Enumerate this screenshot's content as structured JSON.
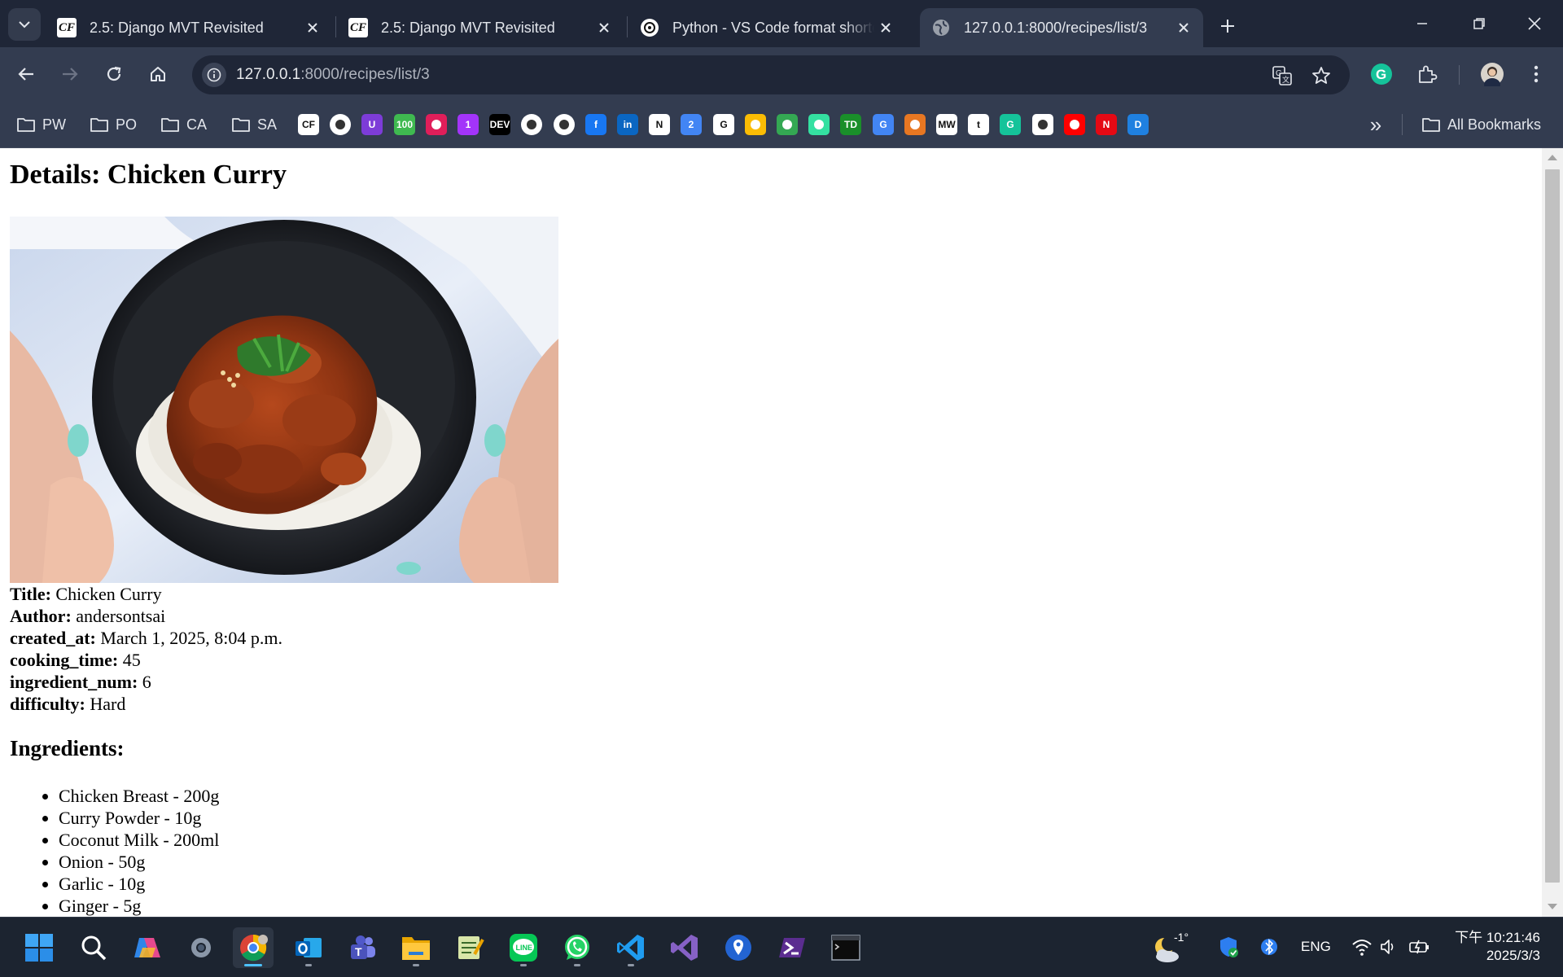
{
  "tabs": [
    {
      "title": "2.5: Django MVT Revisited",
      "favicon": "cf-icon",
      "active": false
    },
    {
      "title": "2.5: Django MVT Revisited",
      "favicon": "cf-icon",
      "active": false
    },
    {
      "title": "Python - VS Code format shortcut",
      "favicon": "chatgpt-icon",
      "active": false
    },
    {
      "title": "127.0.0.1:8000/recipes/list/3",
      "favicon": "globe-icon",
      "active": true
    }
  ],
  "cf_favicon_text": "CF",
  "address_bar": {
    "host": "127.0.0.1",
    "path": ":8000/recipes/list/3"
  },
  "bookmarks": {
    "folders": [
      "PW",
      "PO",
      "CA",
      "SA"
    ],
    "icons": [
      {
        "name": "cf-icon",
        "text": "CF",
        "color": "#ffffff"
      },
      {
        "name": "github-icon",
        "color": "#ffffff"
      },
      {
        "name": "ublock-icon",
        "text": "U",
        "color": "#7d3cd8"
      },
      {
        "name": "hundred-icon",
        "text": "100",
        "color": "#3fb950"
      },
      {
        "name": "slack-icon",
        "color": "#e01e5a"
      },
      {
        "name": "messenger-icon",
        "text": "1",
        "color": "#a334fa"
      },
      {
        "name": "dev-icon",
        "text": "DEV",
        "color": "#000000"
      },
      {
        "name": "chatgpt-icon",
        "color": "#ffffff"
      },
      {
        "name": "perplexity-icon",
        "color": "#ffffff"
      },
      {
        "name": "facebook-icon",
        "text": "f",
        "color": "#1877f2"
      },
      {
        "name": "linkedin-icon",
        "text": "in",
        "color": "#0a66c2"
      },
      {
        "name": "notion-icon",
        "text": "N",
        "color": "#ffffff"
      },
      {
        "name": "calendar-icon",
        "text": "2",
        "color": "#4285f4"
      },
      {
        "name": "google-icon",
        "text": "G",
        "color": "#ffffff"
      },
      {
        "name": "drive-icon",
        "color": "#fbbc04"
      },
      {
        "name": "maps-icon",
        "color": "#34a853"
      },
      {
        "name": "tripadvisor-icon",
        "color": "#34e0a1"
      },
      {
        "name": "td-icon",
        "text": "TD",
        "color": "#1a8f2a"
      },
      {
        "name": "translate-icon",
        "text": "G",
        "color": "#4285f4"
      },
      {
        "name": "university-icon",
        "color": "#e87722"
      },
      {
        "name": "mw-icon",
        "text": "MW",
        "color": "#ffffff"
      },
      {
        "name": "tumblr-icon",
        "text": "t",
        "color": "#ffffff"
      },
      {
        "name": "grammarly-icon",
        "text": "G",
        "color": "#15c39a"
      },
      {
        "name": "bank-icon",
        "color": "#ffffff"
      },
      {
        "name": "youtube-icon",
        "color": "#ff0000"
      },
      {
        "name": "netflix-icon",
        "text": "N",
        "color": "#e50914"
      },
      {
        "name": "disney-icon",
        "text": "D",
        "color": "#1f80e0"
      }
    ],
    "overflow": "»",
    "all_bookmarks": "All Bookmarks"
  },
  "page": {
    "heading": "Details: Chicken Curry",
    "fields": [
      {
        "label": "Title:",
        "value": "Chicken Curry"
      },
      {
        "label": "Author:",
        "value": "andersontsai"
      },
      {
        "label": "created_at:",
        "value": "March 1, 2025, 8:04 p.m."
      },
      {
        "label": "cooking_time:",
        "value": "45"
      },
      {
        "label": "ingredient_num:",
        "value": "6"
      },
      {
        "label": "difficulty:",
        "value": "Hard"
      }
    ],
    "ingredients_heading": "Ingredients:",
    "ingredients": [
      "Chicken Breast - 200g",
      "Curry Powder - 10g",
      "Coconut Milk - 200ml",
      "Onion - 50g",
      "Garlic - 10g",
      "Ginger - 5g"
    ]
  },
  "taskbar": {
    "apps": [
      "start-icon",
      "search-icon",
      "copilot-icon",
      "settings-icon",
      "chrome-icon",
      "outlook-icon",
      "teams-icon",
      "file-explorer-icon",
      "notepad-icon",
      "line-icon",
      "whatsapp-icon",
      "vscode-icon",
      "visual-studio-icon",
      "maps-pin-icon",
      "powershell-icon",
      "terminal-icon"
    ],
    "line_label": "LINE",
    "weather": "-1°",
    "lang": "ENG",
    "time": "下午 10:21:46",
    "date": "2025/3/3"
  }
}
